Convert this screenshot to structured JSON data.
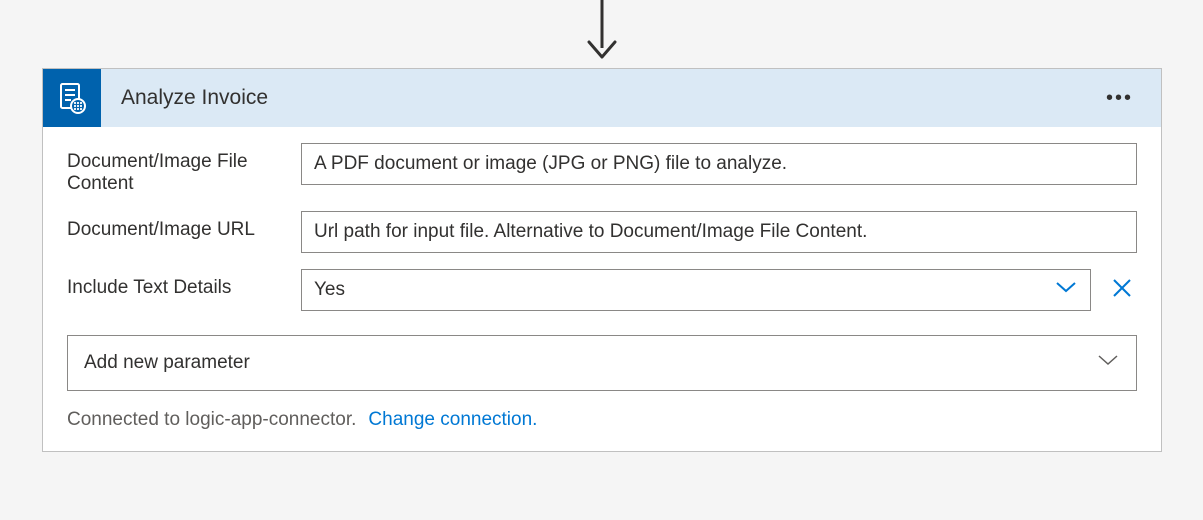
{
  "card": {
    "title": "Analyze Invoice"
  },
  "fields": {
    "file_content": {
      "label": "Document/Image File Content",
      "placeholder": "A PDF document or image (JPG or PNG) file to analyze."
    },
    "image_url": {
      "label": "Document/Image URL",
      "placeholder": "Url path for input file. Alternative to Document/Image File Content."
    },
    "include_text": {
      "label": "Include Text Details",
      "value": "Yes"
    }
  },
  "add_param": {
    "label": "Add new parameter"
  },
  "footer": {
    "connected_text": "Connected to logic-app-connector.",
    "change_link": "Change connection."
  }
}
